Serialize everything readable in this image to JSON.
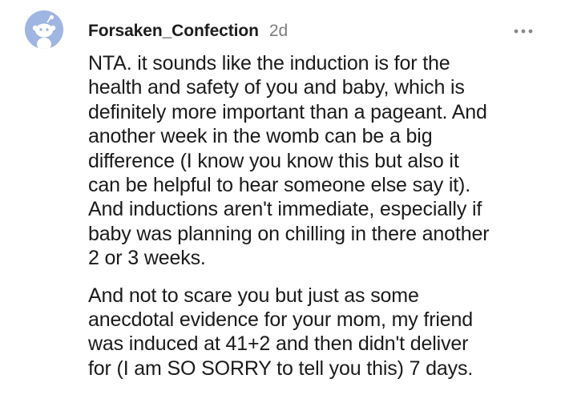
{
  "comment": {
    "author": "Forsaken_Confection",
    "age": "2d",
    "avatar_icon": "reddit-snoo-avatar-icon",
    "more_icon": "more-options-icon",
    "paragraphs": [
      {
        "lines": [
          "NTA. it sounds like the induction is for the",
          "health and safety of you and baby, which is",
          "definitely more important than a pageant. And",
          "another week in the womb can be a big",
          "difference (I know you know this but also it",
          "can be helpful to hear someone else say it).",
          "And inductions aren't immediate, especially if",
          "baby was planning on chilling in there another",
          "2 or 3 weeks."
        ]
      },
      {
        "lines": [
          "And not to scare you but just as some",
          "anecdotal evidence for your mom, my friend",
          "was induced at 41+2 and then didn't deliver",
          "for (I am SO SORRY to tell you this) 7 days."
        ]
      }
    ]
  },
  "colors": {
    "avatar_bg": "#9fb6e2",
    "text": "#1a1a1b",
    "muted": "#7c7c7c"
  }
}
